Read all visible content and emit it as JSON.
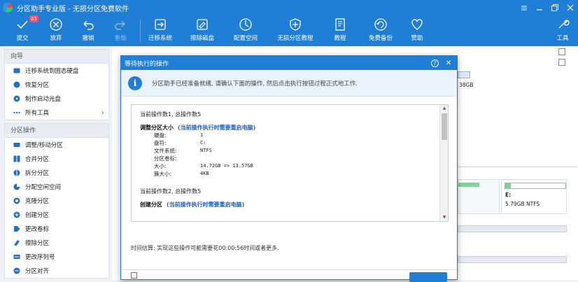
{
  "window": {
    "title": "分区助手专业版 - 无损分区免费软件",
    "controls": [
      "minimize-icon",
      "restore-icon",
      "maximize-icon",
      "close-icon"
    ]
  },
  "toolbar": {
    "badge": "05",
    "buttons": [
      {
        "label": "提交",
        "icon": "check-icon",
        "enabled": true
      },
      {
        "label": "放弃",
        "icon": "cancel-circle-icon",
        "enabled": true
      },
      {
        "label": "撤销",
        "icon": "undo-icon",
        "enabled": true
      },
      {
        "label": "重做",
        "icon": "redo-icon",
        "enabled": false
      },
      {
        "label": "迁移系统",
        "icon": "migrate-os-icon",
        "enabled": true
      },
      {
        "label": "擦除磁盘",
        "icon": "wipe-disk-icon",
        "enabled": true
      },
      {
        "label": "配置空间",
        "icon": "allocate-space-icon",
        "enabled": true
      },
      {
        "label": "无损分区教程",
        "icon": "shield-icon",
        "enabled": true
      },
      {
        "label": "教程",
        "icon": "tutorial-icon",
        "enabled": true
      },
      {
        "label": "免费备份",
        "icon": "backup-icon",
        "enabled": true
      },
      {
        "label": "赞助",
        "icon": "sponsor-icon",
        "enabled": true
      },
      {
        "label": "工具",
        "icon": "tools-icon",
        "enabled": true
      }
    ]
  },
  "sidebar": {
    "wizard_title": "向导",
    "wizard_items": [
      {
        "label": "迁移系统到固态硬盘",
        "icon": "migrate-icon"
      },
      {
        "label": "恢复分区",
        "icon": "recover-icon"
      },
      {
        "label": "制作启动光盘",
        "icon": "boot-disc-icon"
      },
      {
        "label": "所有工具",
        "icon": "more-icon",
        "arrow": "›"
      }
    ],
    "ops_title": "分区操作",
    "ops_items": [
      {
        "label": "调整/移动分区",
        "icon": "resize-icon"
      },
      {
        "label": "合并分区",
        "icon": "merge-icon"
      },
      {
        "label": "拆分分区",
        "icon": "split-icon"
      },
      {
        "label": "分配空闲空间",
        "icon": "allocate-icon"
      },
      {
        "label": "克隆分区",
        "icon": "clone-icon"
      },
      {
        "label": "创建分区",
        "icon": "create-icon"
      },
      {
        "label": "更改卷标",
        "icon": "label-icon"
      },
      {
        "label": "擦除分区",
        "icon": "wipe-icon"
      },
      {
        "label": "更改序列号",
        "icon": "serial-icon"
      },
      {
        "label": "分区对齐",
        "icon": "align-icon"
      }
    ]
  },
  "background": {
    "disk_size_fragment": "38GB",
    "drive_letter": "E:",
    "drive_info": "5.79GB NTFS"
  },
  "dialog": {
    "title": "等待执行的操作",
    "help": "?",
    "close": "✕",
    "info_text": "分区助手已经准备就绪, 请确认下面的操作, 然后点击执行按钮过程正式地工作.",
    "ops": [
      {
        "header": "当前操作数1, 总操作数5",
        "name": "调整分区大小",
        "note": "(当前操作执行时需要重启电脑)",
        "details": [
          {
            "key": "硬盘:",
            "value": "1"
          },
          {
            "key": "盘符:",
            "value": "C:"
          },
          {
            "key": "文件系统:",
            "value": "NTFS"
          },
          {
            "key": "分区卷标:",
            "value": ""
          },
          {
            "key": "大小:",
            "value": "14.72GB => 13.57GB"
          },
          {
            "key": "簇大小:",
            "value": "4KB"
          }
        ]
      },
      {
        "header": "当前操作数2, 总操作数5",
        "name": "创建分区",
        "note": "(当前操作执行时需要重启电脑)",
        "details": []
      }
    ],
    "time_estimate": "时间估算: 实现这些操作可能需要花00:00:56时间或者更多."
  }
}
